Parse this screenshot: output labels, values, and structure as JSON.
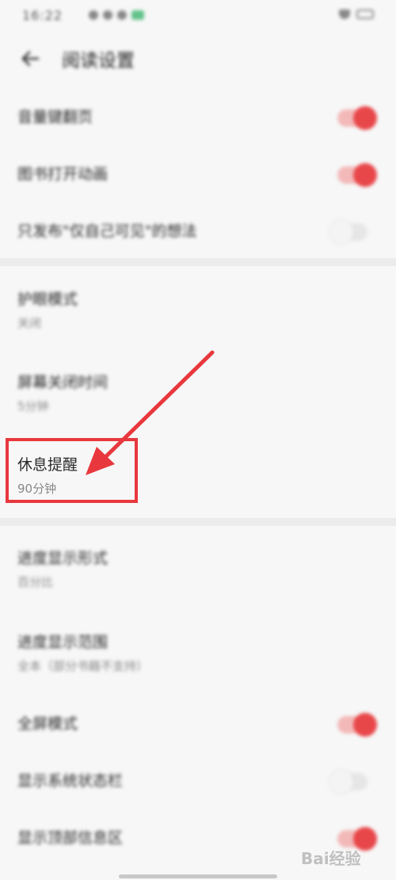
{
  "status": {
    "time": "16:22"
  },
  "header": {
    "title": "阅读设置"
  },
  "group1": [
    {
      "label": "音量键翻页",
      "toggle": true
    },
    {
      "label": "图书打开动画",
      "toggle": true
    },
    {
      "label": "只发布\"仅自己可见\"的想法",
      "toggle": false
    }
  ],
  "group2": [
    {
      "label": "护眼模式",
      "sub": "关闭"
    },
    {
      "label": "屏幕关闭时间",
      "sub": "5分钟"
    },
    {
      "label": "休息提醒",
      "sub": "90分钟"
    }
  ],
  "group3": [
    {
      "label": "进度显示形式",
      "sub": "百分比"
    },
    {
      "label": "进度显示范围",
      "sub": "全本（部分书籍不支持）"
    },
    {
      "label": "全屏模式",
      "toggle": true
    },
    {
      "label": "显示系统状态栏",
      "toggle": false
    },
    {
      "label": "显示顶部信息区",
      "toggle": true
    }
  ],
  "watermark": "Bai经验",
  "colors": {
    "accent": "#e8474a",
    "highlight": "#e8383d"
  }
}
